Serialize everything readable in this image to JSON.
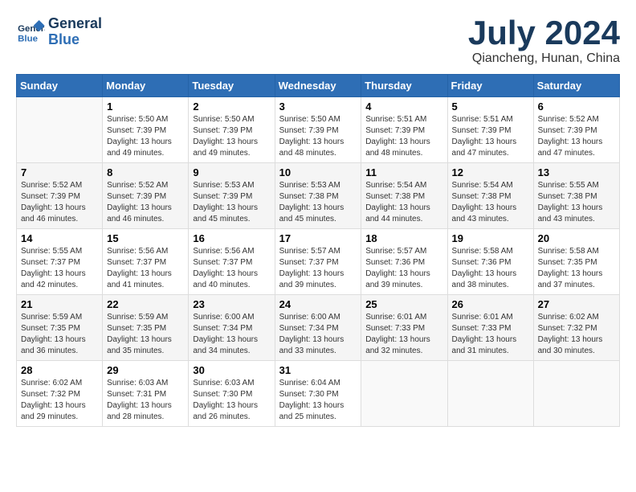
{
  "header": {
    "logo_line1": "General",
    "logo_line2": "Blue",
    "month_title": "July 2024",
    "location": "Qiancheng, Hunan, China"
  },
  "weekdays": [
    "Sunday",
    "Monday",
    "Tuesday",
    "Wednesday",
    "Thursday",
    "Friday",
    "Saturday"
  ],
  "weeks": [
    [
      {
        "day": "",
        "info": ""
      },
      {
        "day": "1",
        "info": "Sunrise: 5:50 AM\nSunset: 7:39 PM\nDaylight: 13 hours\nand 49 minutes."
      },
      {
        "day": "2",
        "info": "Sunrise: 5:50 AM\nSunset: 7:39 PM\nDaylight: 13 hours\nand 49 minutes."
      },
      {
        "day": "3",
        "info": "Sunrise: 5:50 AM\nSunset: 7:39 PM\nDaylight: 13 hours\nand 48 minutes."
      },
      {
        "day": "4",
        "info": "Sunrise: 5:51 AM\nSunset: 7:39 PM\nDaylight: 13 hours\nand 48 minutes."
      },
      {
        "day": "5",
        "info": "Sunrise: 5:51 AM\nSunset: 7:39 PM\nDaylight: 13 hours\nand 47 minutes."
      },
      {
        "day": "6",
        "info": "Sunrise: 5:52 AM\nSunset: 7:39 PM\nDaylight: 13 hours\nand 47 minutes."
      }
    ],
    [
      {
        "day": "7",
        "info": "Sunrise: 5:52 AM\nSunset: 7:39 PM\nDaylight: 13 hours\nand 46 minutes."
      },
      {
        "day": "8",
        "info": "Sunrise: 5:52 AM\nSunset: 7:39 PM\nDaylight: 13 hours\nand 46 minutes."
      },
      {
        "day": "9",
        "info": "Sunrise: 5:53 AM\nSunset: 7:39 PM\nDaylight: 13 hours\nand 45 minutes."
      },
      {
        "day": "10",
        "info": "Sunrise: 5:53 AM\nSunset: 7:38 PM\nDaylight: 13 hours\nand 45 minutes."
      },
      {
        "day": "11",
        "info": "Sunrise: 5:54 AM\nSunset: 7:38 PM\nDaylight: 13 hours\nand 44 minutes."
      },
      {
        "day": "12",
        "info": "Sunrise: 5:54 AM\nSunset: 7:38 PM\nDaylight: 13 hours\nand 43 minutes."
      },
      {
        "day": "13",
        "info": "Sunrise: 5:55 AM\nSunset: 7:38 PM\nDaylight: 13 hours\nand 43 minutes."
      }
    ],
    [
      {
        "day": "14",
        "info": "Sunrise: 5:55 AM\nSunset: 7:37 PM\nDaylight: 13 hours\nand 42 minutes."
      },
      {
        "day": "15",
        "info": "Sunrise: 5:56 AM\nSunset: 7:37 PM\nDaylight: 13 hours\nand 41 minutes."
      },
      {
        "day": "16",
        "info": "Sunrise: 5:56 AM\nSunset: 7:37 PM\nDaylight: 13 hours\nand 40 minutes."
      },
      {
        "day": "17",
        "info": "Sunrise: 5:57 AM\nSunset: 7:37 PM\nDaylight: 13 hours\nand 39 minutes."
      },
      {
        "day": "18",
        "info": "Sunrise: 5:57 AM\nSunset: 7:36 PM\nDaylight: 13 hours\nand 39 minutes."
      },
      {
        "day": "19",
        "info": "Sunrise: 5:58 AM\nSunset: 7:36 PM\nDaylight: 13 hours\nand 38 minutes."
      },
      {
        "day": "20",
        "info": "Sunrise: 5:58 AM\nSunset: 7:35 PM\nDaylight: 13 hours\nand 37 minutes."
      }
    ],
    [
      {
        "day": "21",
        "info": "Sunrise: 5:59 AM\nSunset: 7:35 PM\nDaylight: 13 hours\nand 36 minutes."
      },
      {
        "day": "22",
        "info": "Sunrise: 5:59 AM\nSunset: 7:35 PM\nDaylight: 13 hours\nand 35 minutes."
      },
      {
        "day": "23",
        "info": "Sunrise: 6:00 AM\nSunset: 7:34 PM\nDaylight: 13 hours\nand 34 minutes."
      },
      {
        "day": "24",
        "info": "Sunrise: 6:00 AM\nSunset: 7:34 PM\nDaylight: 13 hours\nand 33 minutes."
      },
      {
        "day": "25",
        "info": "Sunrise: 6:01 AM\nSunset: 7:33 PM\nDaylight: 13 hours\nand 32 minutes."
      },
      {
        "day": "26",
        "info": "Sunrise: 6:01 AM\nSunset: 7:33 PM\nDaylight: 13 hours\nand 31 minutes."
      },
      {
        "day": "27",
        "info": "Sunrise: 6:02 AM\nSunset: 7:32 PM\nDaylight: 13 hours\nand 30 minutes."
      }
    ],
    [
      {
        "day": "28",
        "info": "Sunrise: 6:02 AM\nSunset: 7:32 PM\nDaylight: 13 hours\nand 29 minutes."
      },
      {
        "day": "29",
        "info": "Sunrise: 6:03 AM\nSunset: 7:31 PM\nDaylight: 13 hours\nand 28 minutes."
      },
      {
        "day": "30",
        "info": "Sunrise: 6:03 AM\nSunset: 7:30 PM\nDaylight: 13 hours\nand 26 minutes."
      },
      {
        "day": "31",
        "info": "Sunrise: 6:04 AM\nSunset: 7:30 PM\nDaylight: 13 hours\nand 25 minutes."
      },
      {
        "day": "",
        "info": ""
      },
      {
        "day": "",
        "info": ""
      },
      {
        "day": "",
        "info": ""
      }
    ]
  ]
}
